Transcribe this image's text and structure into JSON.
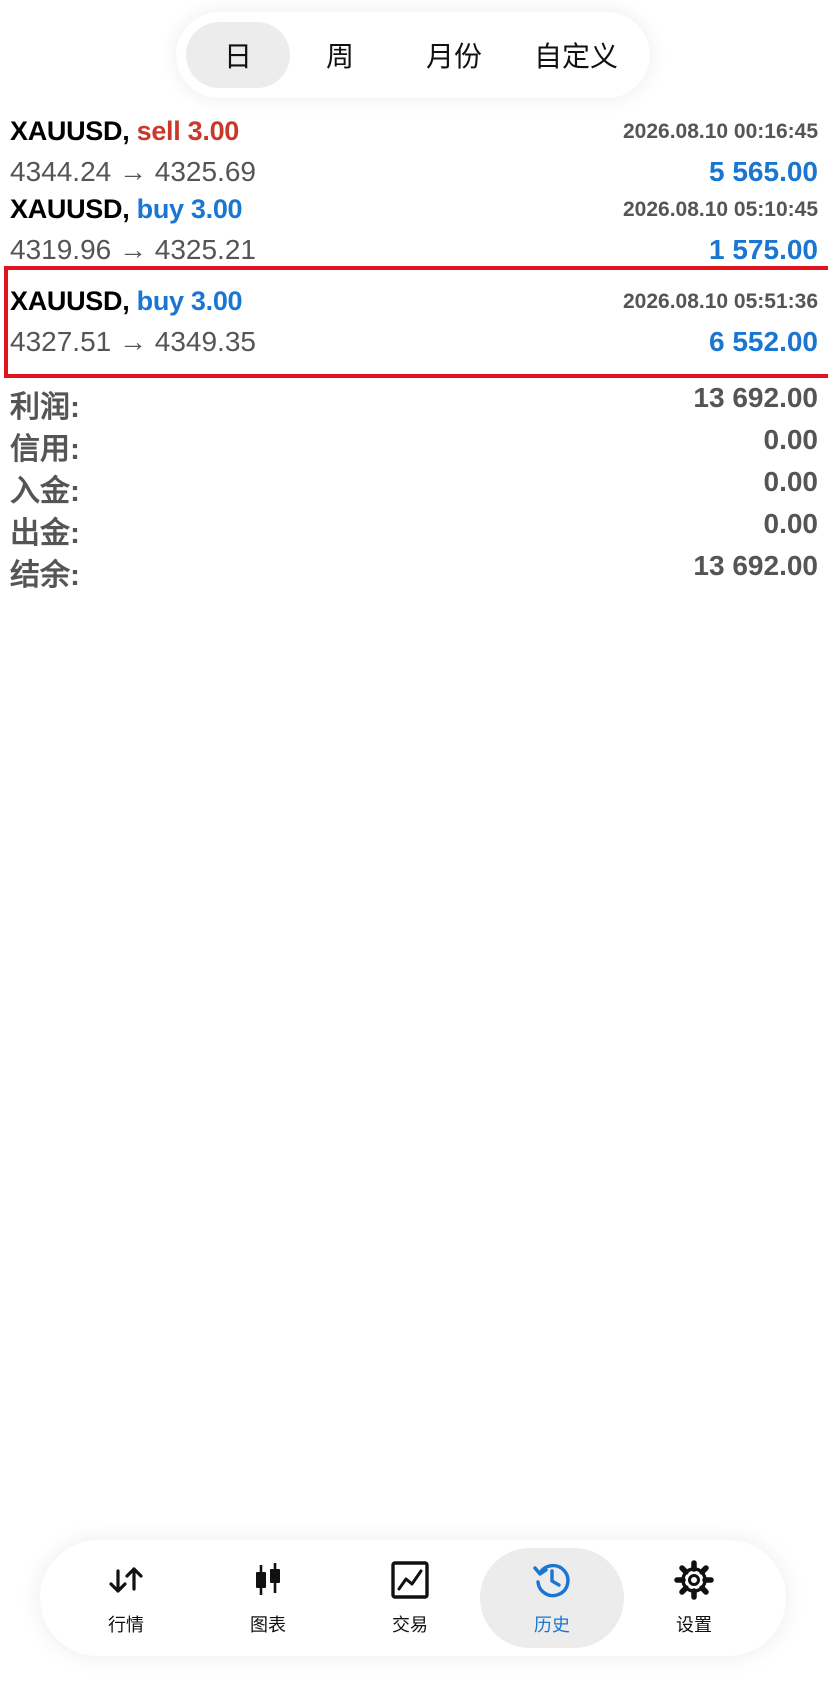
{
  "periods": [
    {
      "label": "日",
      "active": true
    },
    {
      "label": "周",
      "active": false
    },
    {
      "label": "月份",
      "active": false
    },
    {
      "label": "自定义",
      "active": false
    }
  ],
  "deals": [
    {
      "symbol": "XAUUSD,",
      "side": "sell 3.00",
      "time": "2026.08.10 00:16:45",
      "prices": "4344.24 → 4325.69",
      "profit": "5 565.00"
    },
    {
      "symbol": "XAUUSD,",
      "side": "buy 3.00",
      "time": "2026.08.10 05:10:45",
      "prices": "4319.96 → 4325.21",
      "profit": "1 575.00"
    },
    {
      "symbol": "XAUUSD,",
      "side": "buy 3.00",
      "time": "2026.08.10 05:51:36",
      "prices": "4327.51 → 4349.35",
      "profit": "6 552.00"
    }
  ],
  "summary": [
    {
      "label": "利润:",
      "value": "13 692.00"
    },
    {
      "label": "信用:",
      "value": "0.00"
    },
    {
      "label": "入金:",
      "value": "0.00"
    },
    {
      "label": "出金:",
      "value": "0.00"
    },
    {
      "label": "结余:",
      "value": "13 692.00"
    }
  ],
  "nav": [
    {
      "label": "行情",
      "icon": "quotes-arrows-icon",
      "active": false
    },
    {
      "label": "图表",
      "icon": "candlestick-chart-icon",
      "active": false
    },
    {
      "label": "交易",
      "icon": "trade-line-chart-icon",
      "active": false
    },
    {
      "label": "历史",
      "icon": "history-clock-icon",
      "active": true
    },
    {
      "label": "设置",
      "icon": "gear-icon",
      "active": false
    }
  ],
  "colors": {
    "sell": "#c8392b",
    "buy": "#1976d2",
    "profit": "#1976d2",
    "highlight": "#e0141e",
    "active_nav": "#1976d2"
  }
}
